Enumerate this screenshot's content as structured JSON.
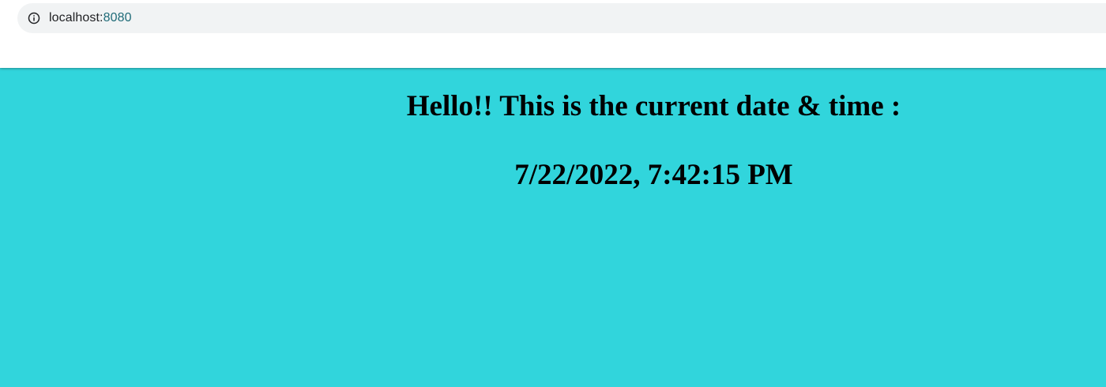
{
  "browser": {
    "url_host": "localhost:",
    "url_port": "8080"
  },
  "page": {
    "greeting": "Hello!! This is the current date & time :",
    "datetime": "7/22/2022, 7:42:15 PM",
    "background_color": "#31d5dc"
  }
}
